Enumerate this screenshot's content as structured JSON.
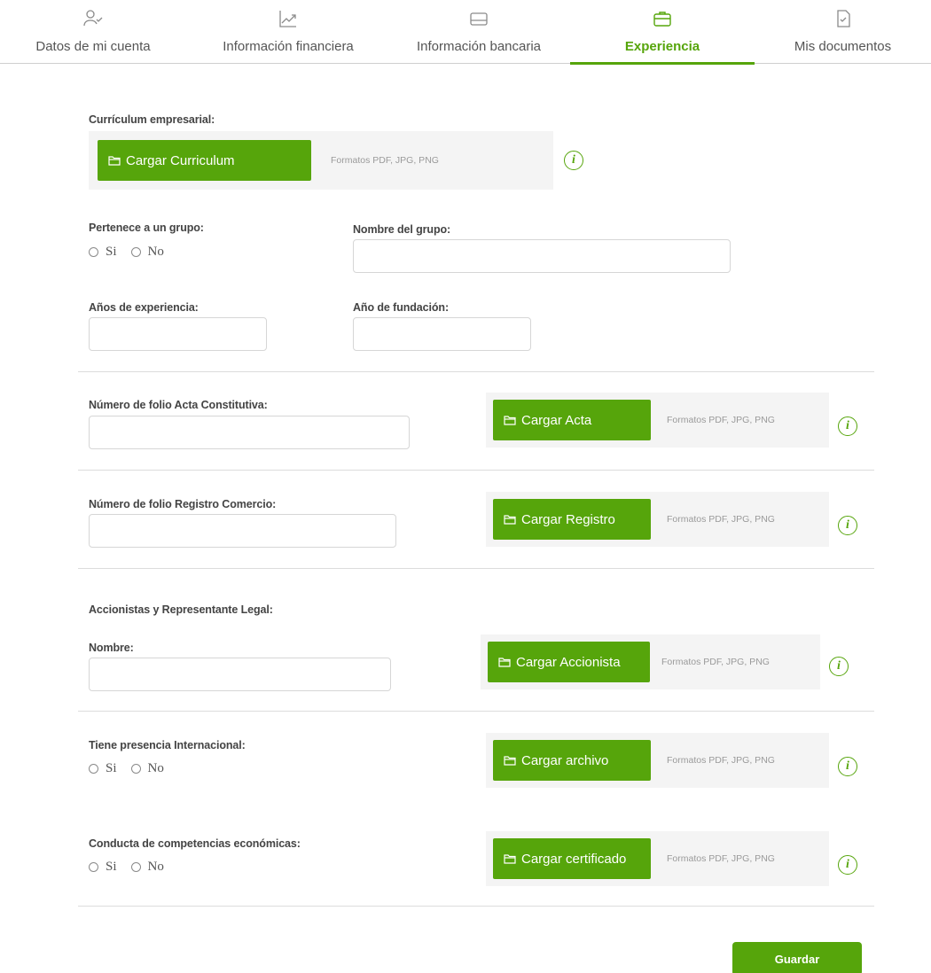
{
  "tabs": [
    {
      "label": "Datos de mi cuenta",
      "icon": "user-check-icon",
      "active": false
    },
    {
      "label": "Información financiera",
      "icon": "chart-line-icon",
      "active": false
    },
    {
      "label": "Información bancaria",
      "icon": "card-icon",
      "active": false
    },
    {
      "label": "Experiencia",
      "icon": "briefcase-icon",
      "active": true
    },
    {
      "label": "Mis documentos",
      "icon": "document-check-icon",
      "active": false
    }
  ],
  "accent_color": "#56a50b",
  "curriculum": {
    "label": "Currículum empresarial:",
    "button": "Cargar Curriculum",
    "formats": "Formatos PDF, JPG, PNG"
  },
  "grupo": {
    "label": "Pertenece a un grupo:",
    "options": [
      "Si",
      "No"
    ],
    "nombre_label": "Nombre del grupo:",
    "nombre_value": ""
  },
  "anios_experiencia": {
    "label": "Años de experiencia:",
    "value": ""
  },
  "anio_fundacion": {
    "label": "Año de fundación:",
    "value": ""
  },
  "acta": {
    "label": "Número de folio Acta Constitutiva:",
    "value": "",
    "button": "Cargar Acta",
    "formats": "Formatos PDF, JPG, PNG"
  },
  "registro": {
    "label": "Número de folio Registro Comercio:",
    "value": "",
    "button": "Cargar Registro",
    "formats": "Formatos PDF, JPG, PNG"
  },
  "accionistas": {
    "section_label": "Accionistas y Representante Legal:",
    "nombre_label": "Nombre:",
    "nombre_value": "",
    "button": "Cargar Accionista",
    "formats": "Formatos PDF, JPG, PNG"
  },
  "internacional": {
    "label": "Tiene presencia Internacional:",
    "options": [
      "Si",
      "No"
    ],
    "button": "Cargar archivo",
    "formats": "Formatos PDF, JPG, PNG"
  },
  "conducta": {
    "label": "Conducta de competencias económicas:",
    "options": [
      "Si",
      "No"
    ],
    "button": "Cargar certificado",
    "formats": "Formatos PDF, JPG, PNG"
  },
  "save_label": "Guardar"
}
